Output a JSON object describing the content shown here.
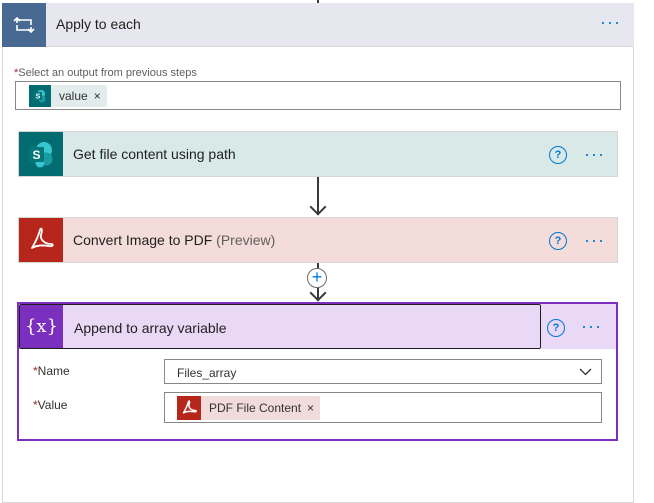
{
  "loop": {
    "title": "Apply to each",
    "icon": "loop-icon",
    "output_label": "Select an output from previous steps",
    "required_marker": "*",
    "token_label": "value",
    "token_close": "×"
  },
  "actions": [
    {
      "title": "Get file content using path",
      "preview": "",
      "icon": "sharepoint-icon",
      "help": "?",
      "accent": "#036c70",
      "bg": "#d8e9e8"
    },
    {
      "title": "Convert Image to PDF",
      "preview": "(Preview)",
      "icon": "adobe-acrobat-icon",
      "help": "?",
      "accent": "#b7261b",
      "bg": "#f3dcda"
    }
  ],
  "connector": {
    "plus": "+"
  },
  "append": {
    "title": "Append to array variable",
    "icon": "variable-icon",
    "icon_text": "{x}",
    "help": "?",
    "accent": "#7b2fbe",
    "name_label": "Name",
    "name_value": "Files_array",
    "value_label": "Value",
    "value_token": "PDF File Content",
    "value_token_close": "×"
  },
  "menu_dots": "···",
  "colors": {
    "link_blue": "#0078d4",
    "required_red": "#a4262c"
  }
}
